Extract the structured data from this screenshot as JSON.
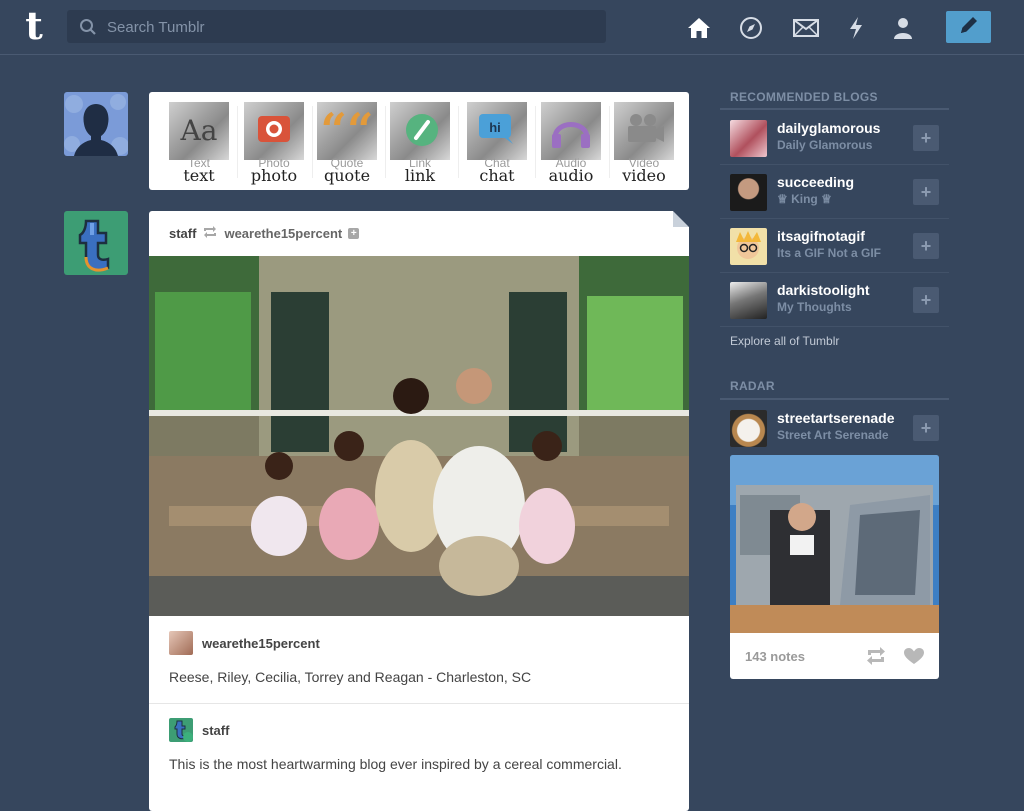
{
  "topbar": {
    "logo_letter": "t",
    "search_placeholder": "Search Tumblr",
    "nav_icons": [
      "home-icon",
      "compass-icon",
      "mail-icon",
      "lightning-icon",
      "person-icon",
      "pencil-icon"
    ]
  },
  "post_types": [
    {
      "label": "Text",
      "hand": "text"
    },
    {
      "label": "Photo",
      "hand": "photo"
    },
    {
      "label": "Quote",
      "hand": "quote"
    },
    {
      "label": "Link",
      "hand": "link"
    },
    {
      "label": "Chat",
      "hand": "chat"
    },
    {
      "label": "Audio",
      "hand": "audio"
    },
    {
      "label": "Video",
      "hand": "video"
    }
  ],
  "post": {
    "author": "staff",
    "reblogged_from": "wearethe15percent",
    "source_name": "wearethe15percent",
    "caption": "Reese, Riley, Cecilia, Torrey and Reagan - Charleston, SC",
    "second_author": "staff",
    "second_body": "This is the most heartwarming blog ever inspired by a cereal commercial."
  },
  "sidebar": {
    "recommended_heading": "RECOMMENDED BLOGS",
    "blogs": [
      {
        "name": "dailyglamorous",
        "title": "Daily Glamorous"
      },
      {
        "name": "succeeding",
        "title": "♕ King ♕"
      },
      {
        "name": "itsagifnotagif",
        "title": "Its a GIF Not a GIF"
      },
      {
        "name": "darkistoolight",
        "title": "My Thoughts"
      }
    ],
    "explore_label": "Explore all of Tumblr",
    "radar_heading": "RADAR",
    "radar": {
      "name": "streetartserenade",
      "title": "Street Art Serenade",
      "notes": "143 notes"
    },
    "add_label": "+"
  },
  "colors": {
    "background": "#36465d",
    "accent": "#529ecc",
    "card": "#ffffff",
    "muted": "#7d8ea5"
  }
}
